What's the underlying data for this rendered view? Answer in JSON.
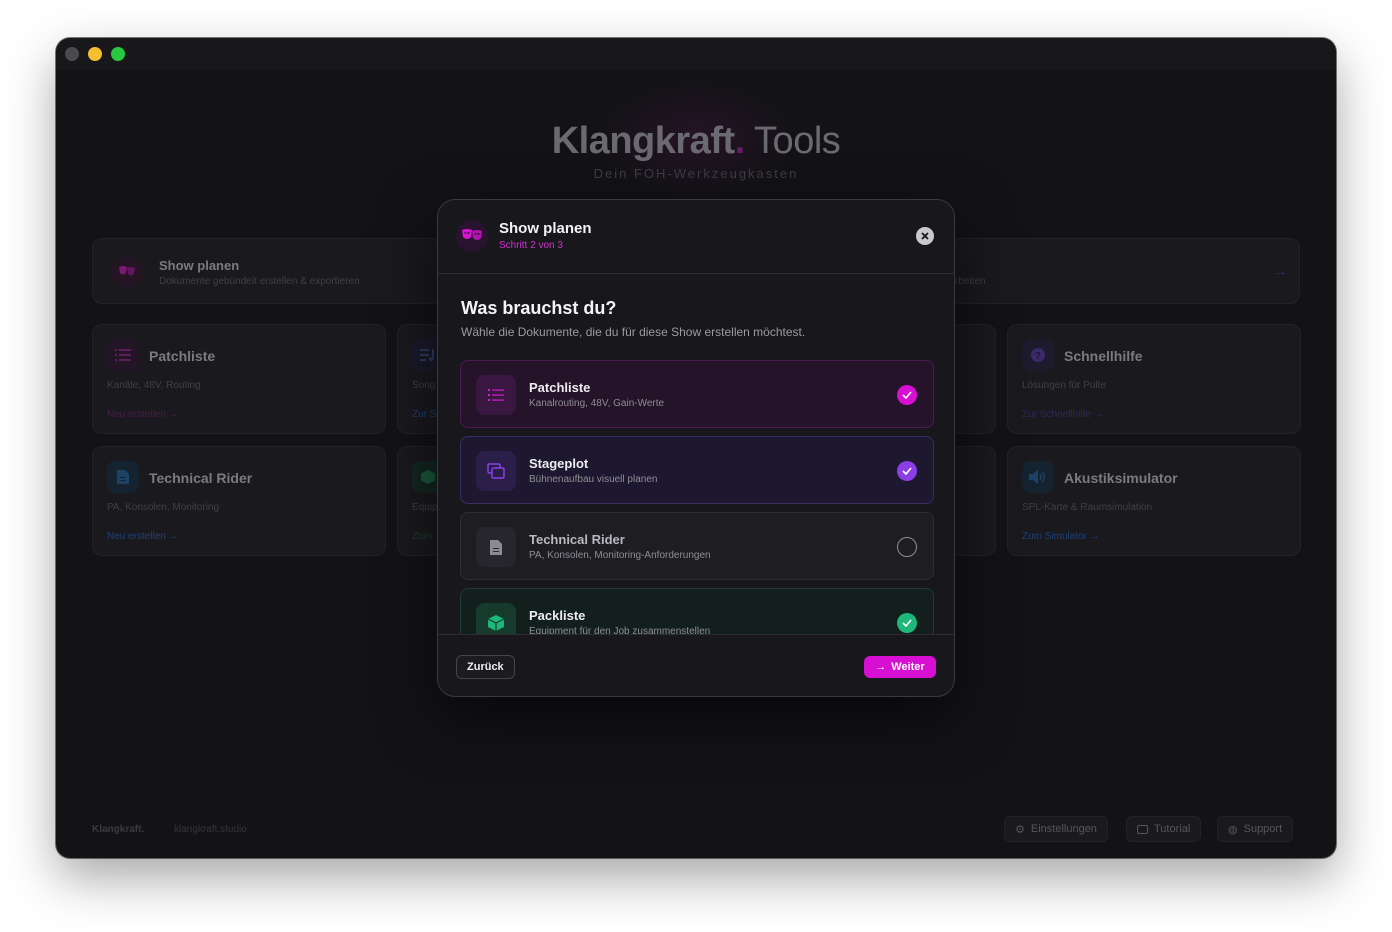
{
  "app": {
    "brand_main": "Klangkraft",
    "brand_dot": ".",
    "brand_suffix": " Tools",
    "brand_sub": "Dein FOH-Werkzeugkasten"
  },
  "hero": {
    "title": "Show planen",
    "subtitle": "Dokumente gebündelt erstellen & exportieren",
    "right_fragment": "rbeiten"
  },
  "cards": {
    "patchliste": {
      "title": "Patchliste",
      "subtitle": "Kanäle, 48V, Routing",
      "link": "Neu erstellen →"
    },
    "song": {
      "subtitle": "Song",
      "link": "Zur S"
    },
    "schnellhilfe": {
      "title": "Schnellhilfe",
      "subtitle": "Lösungen für Pulte",
      "link": "Zur Schnellhilfe →"
    },
    "rider": {
      "title": "Technical Rider",
      "subtitle": "PA, Konsolen, Monitoring",
      "link": "Neu erstellen →"
    },
    "equip": {
      "subtitle": "Equip",
      "link": "Zum"
    },
    "akustik": {
      "title": "Akustiksimulator",
      "subtitle": "SPL-Karte & Raumsimulation",
      "link": "Zum Simulator →"
    }
  },
  "footer": {
    "brand": "Klangkraft.",
    "sep": "·",
    "url": "klangkraft.studio",
    "buttons": [
      "Einstellungen",
      "Tutorial",
      "Support"
    ]
  },
  "modal": {
    "title": "Show planen",
    "step": "Schritt 2 von 3",
    "question": "Was brauchst du?",
    "question_sub": "Wähle die Dokumente, die du für diese Show erstellen möchtest.",
    "options": [
      {
        "title": "Patchliste",
        "subtitle": "Kanalrouting, 48V, Gain-Werte",
        "checked": true
      },
      {
        "title": "Stageplot",
        "subtitle": "Bühnenaufbau visuell planen",
        "checked": true
      },
      {
        "title": "Technical Rider",
        "subtitle": "PA, Konsolen, Monitoring-Anforderungen",
        "checked": false
      },
      {
        "title": "Packliste",
        "subtitle": "Equipment für den Job zusammenstellen",
        "checked": true
      }
    ],
    "back_label": "Zurück",
    "next_label": "Weiter"
  },
  "colors": {
    "accent_magenta": "#d60fd3",
    "accent_purple": "#8b3ee6",
    "accent_green": "#1fb67a",
    "background": "#131316"
  }
}
